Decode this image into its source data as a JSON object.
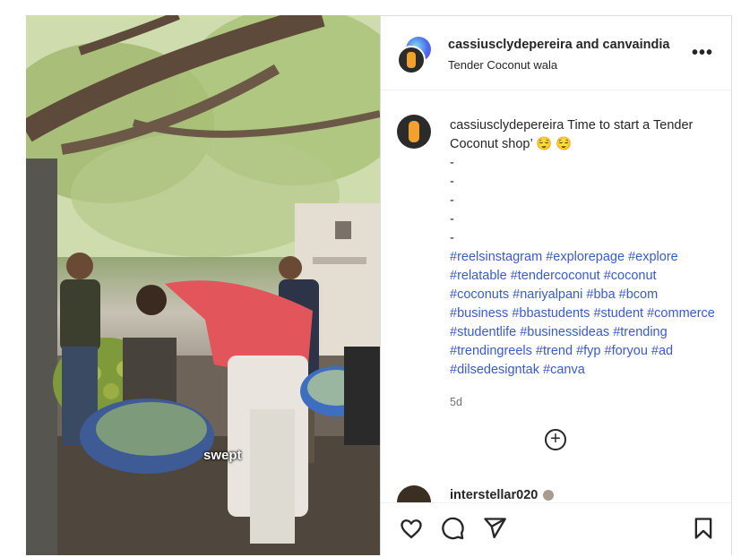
{
  "media": {
    "overlay_caption": "swept"
  },
  "header": {
    "user1": "cassiusclydepereira",
    "and": "and",
    "user2": "canvaindia",
    "subtitle": "Tender Coconut wala",
    "more_icon": "more-horizontal-icon"
  },
  "caption": {
    "username": "cassiusclydepereira",
    "text": "Time to start a Tender Coconut shop’ 😌 😌",
    "dashes": [
      "-",
      "-",
      "-",
      "-",
      "-"
    ],
    "hashtags": [
      "#reelsinstagram",
      "#explorepage",
      "#explore",
      "#relatable",
      "#tendercoconut",
      "#coconut",
      "#coconuts",
      "#nariyalpani",
      "#bba",
      "#bcom",
      "#business",
      "#bbastudents",
      "#student",
      "#commerce",
      "#studentlife",
      "#businessideas",
      "#trending",
      "#trendingreels",
      "#trend",
      "#fyp",
      "#foryou",
      "#ad",
      "#dilsedesigntak",
      "#canva"
    ],
    "time": "5d"
  },
  "load_more": {
    "icon": "plus-circle-icon"
  },
  "comment": {
    "username": "interstellar020"
  },
  "actions": {
    "like_icon": "heart-icon",
    "comment_icon": "comment-icon",
    "share_icon": "send-icon",
    "save_icon": "bookmark-icon"
  }
}
